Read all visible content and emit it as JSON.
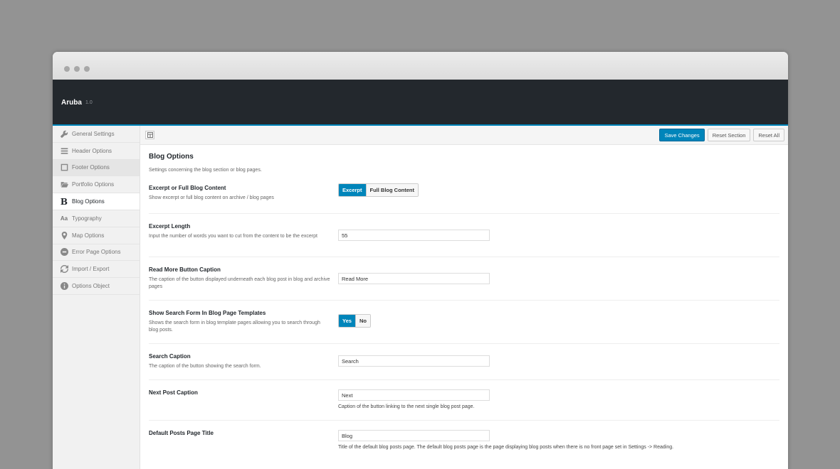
{
  "app": {
    "name": "Aruba",
    "version": "1.0"
  },
  "sidebar": {
    "items": [
      {
        "label": "General Settings",
        "icon": "wrench-icon"
      },
      {
        "label": "Header Options",
        "icon": "menu-icon"
      },
      {
        "label": "Footer Options",
        "icon": "square-icon"
      },
      {
        "label": "Portfolio Options",
        "icon": "folder-icon"
      },
      {
        "label": "Blog Options",
        "icon": "bold-b-icon"
      },
      {
        "label": "Typography",
        "icon": "typography-icon"
      },
      {
        "label": "Map Options",
        "icon": "map-pin-icon"
      },
      {
        "label": "Error Page Options",
        "icon": "minus-circle-icon"
      },
      {
        "label": "Import / Export",
        "icon": "refresh-icon"
      },
      {
        "label": "Options Object",
        "icon": "info-icon"
      }
    ],
    "active": "Blog Options",
    "hovered": "Footer Options"
  },
  "toolbar": {
    "save_label": "Save Changes",
    "reset_section_label": "Reset Section",
    "reset_all_label": "Reset All"
  },
  "section": {
    "title": "Blog Options",
    "description": "Settings concerning the blog section or blog pages."
  },
  "fields": {
    "excerpt": {
      "title": "Excerpt or Full Blog Content",
      "desc": "Show excerpt or full blog content on archive / blog pages",
      "options": [
        "Excerpt",
        "Full Blog Content"
      ],
      "selected": "Excerpt"
    },
    "excerpt_length": {
      "title": "Excerpt Length",
      "desc": "Input the number of words you want to cut from the content to be the excerpt",
      "value": "55"
    },
    "read_more": {
      "title": "Read More Button Caption",
      "desc": "The caption of the button displayed underneath each blog post in blog and archive pages",
      "value": "Read More"
    },
    "show_search": {
      "title": "Show Search Form In Blog Page Templates",
      "desc": "Shows the search form in blog template pages allowing you to search through blog posts.",
      "options": [
        "Yes",
        "No"
      ],
      "selected": "Yes"
    },
    "search_caption": {
      "title": "Search Caption",
      "desc": "The caption of the button showing the search form.",
      "value": "Search"
    },
    "next_post": {
      "title": "Next Post Caption",
      "value": "Next",
      "help": "Caption of the button linking to the next single blog post page."
    },
    "default_title": {
      "title": "Default Posts Page Title",
      "value": "Blog",
      "help": "Title of the default blog posts page. The default blog posts page is the page displaying blog posts when there is no front page set in Settings -> Reading."
    }
  }
}
